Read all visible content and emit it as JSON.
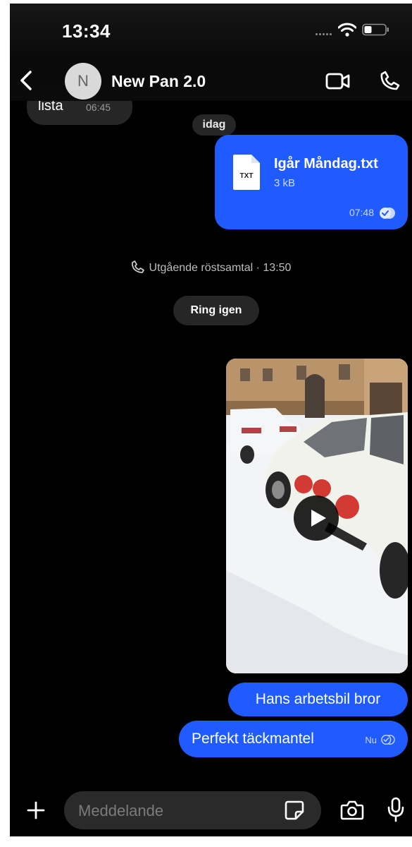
{
  "status_bar": {
    "time": "13:34",
    "icons": [
      "signal-dots-icon",
      "wifi-icon",
      "battery-icon"
    ]
  },
  "header": {
    "avatar_initial": "N",
    "contact_name": "New Pan 2.0",
    "icons": [
      "back-icon",
      "video-call-icon",
      "voice-call-icon"
    ]
  },
  "messages": {
    "previous": {
      "text": "lista",
      "time": "06:45"
    },
    "date_separator": "idag",
    "file": {
      "name": "Igår Måndag.txt",
      "size": "3 kB",
      "type_label": "TXT",
      "time": "07:48"
    },
    "call_log": {
      "text": "Utgående röstsamtal · 13:50",
      "button": "Ring igen"
    },
    "video": {
      "icon": "play-icon"
    },
    "text_messages": [
      {
        "text": "Hans arbetsbil bror",
        "time": ""
      },
      {
        "text": "Perfekt täckmantel",
        "time": "Nu"
      }
    ]
  },
  "composer": {
    "placeholder": "Meddelande",
    "icons": [
      "plus-icon",
      "sticker-icon",
      "camera-icon",
      "mic-icon"
    ]
  },
  "colors": {
    "background": "#000000",
    "bubble_outgoing": "#1f5bff",
    "bubble_incoming": "#262626",
    "input_field": "#2a2a2a",
    "muted_text": "#9a9a9a"
  }
}
